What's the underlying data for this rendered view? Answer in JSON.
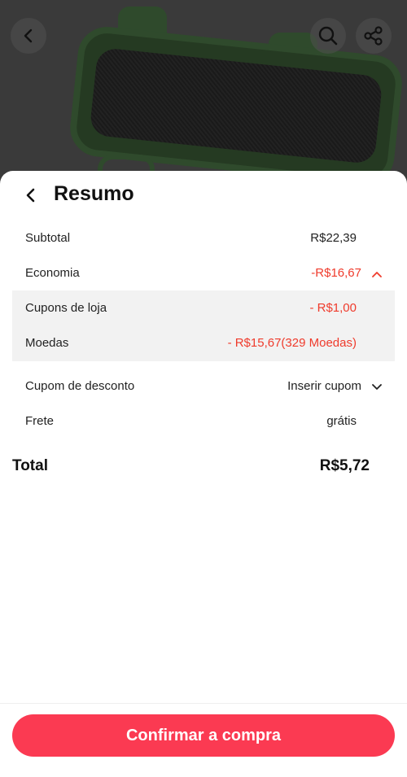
{
  "top_bar": {
    "back_icon": "chevron-left-icon",
    "search_icon": "search-icon",
    "share_icon": "share-icon"
  },
  "sheet": {
    "title": "Resumo",
    "rows": {
      "subtotal": {
        "label": "Subtotal",
        "value": "R$22,39"
      },
      "economia": {
        "label": "Economia",
        "value": "-R$16,67"
      },
      "cupons_loja": {
        "label": "Cupons de loja",
        "value": "- R$1,00"
      },
      "moedas": {
        "label": "Moedas",
        "value": "- R$15,67(329 Moedas)"
      },
      "cupom_desconto": {
        "label": "Cupom de desconto",
        "value": "Inserir cupom"
      },
      "frete": {
        "label": "Frete",
        "value": "grátis"
      }
    },
    "total": {
      "label": "Total",
      "value": "R$5,72"
    }
  },
  "footer": {
    "confirm_label": "Confirmar a compra"
  },
  "colors": {
    "accent": "#fb3a52",
    "discount": "#ef3b2c",
    "sub_block_bg": "#f2f2f2"
  }
}
